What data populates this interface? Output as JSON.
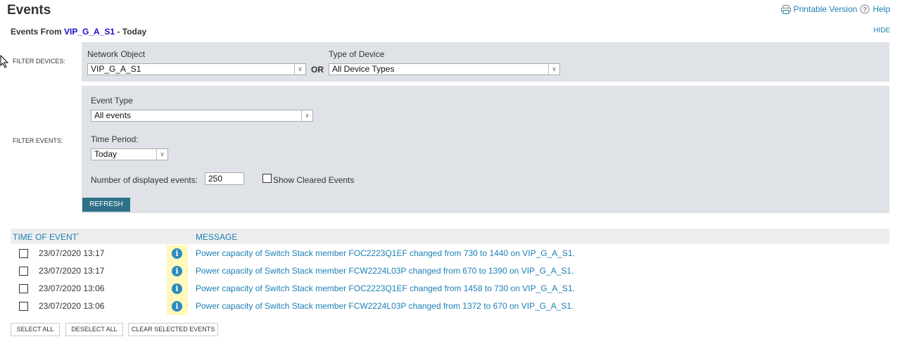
{
  "page": {
    "title": "Events",
    "subtitle_prefix": "Events From",
    "device": "VIP_G_A_S1",
    "subtitle_suffix": "- Today"
  },
  "toplinks": {
    "printable": "Printable Version",
    "help": "Help",
    "hide": "HIDE"
  },
  "filter_devices": {
    "label": "FILTER DEVICES:",
    "network_object_label": "Network Object",
    "network_object_value": "VIP_G_A_S1",
    "or": "OR",
    "device_type_label": "Type of Device",
    "device_type_value": "All Device Types"
  },
  "filter_events": {
    "label": "FILTER EVENTS:",
    "event_type_label": "Event Type",
    "event_type_value": "All events",
    "time_period_label": "Time Period:",
    "time_period_value": "Today",
    "num_events_label": "Number of displayed events:",
    "num_events_value": "250",
    "show_cleared_label": "Show Cleared Events",
    "show_cleared_checked": false
  },
  "refresh_label": "REFRESH",
  "table": {
    "headers": {
      "time": "TIME OF EVENT",
      "message": "MESSAGE"
    },
    "rows": [
      {
        "time": "23/07/2020 13:17",
        "severity": "info",
        "message": "Power capacity of Switch Stack member FOC2223Q1EF changed from 730 to 1440 on VIP_G_A_S1."
      },
      {
        "time": "23/07/2020 13:17",
        "severity": "info",
        "message": "Power capacity of Switch Stack member FCW2224L03P changed from 670 to 1390 on VIP_G_A_S1."
      },
      {
        "time": "23/07/2020 13:06",
        "severity": "info",
        "message": "Power capacity of Switch Stack member FOC2223Q1EF changed from 1458 to 730 on VIP_G_A_S1."
      },
      {
        "time": "23/07/2020 13:06",
        "severity": "info",
        "message": "Power capacity of Switch Stack member FCW2224L03P changed from 1372 to 670 on VIP_G_A_S1."
      }
    ]
  },
  "actions": {
    "select_all": "SELECT ALL",
    "deselect_all": "DESELECT ALL",
    "clear_selected": "CLEAR SELECTED EVENTS"
  },
  "colors": {
    "accent": "#1b7fb5",
    "refresh_button": "#2f7189",
    "panel": "#dfe3e8",
    "info_icon": "#2b8ac0"
  }
}
